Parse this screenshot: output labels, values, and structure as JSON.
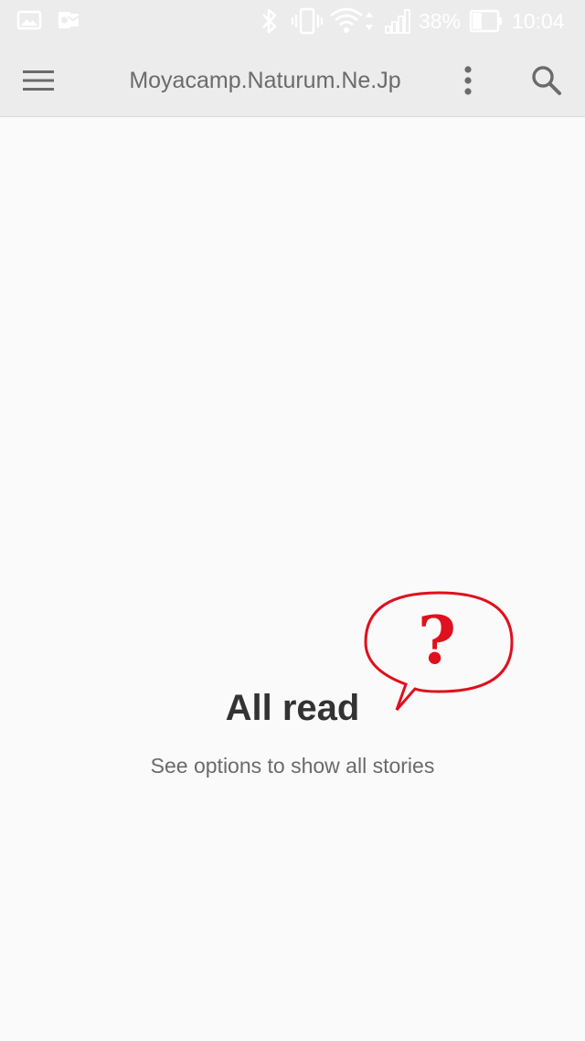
{
  "status_bar": {
    "battery_percent": "38%",
    "time": "10:04",
    "icons": [
      "gallery-icon",
      "outlook-icon",
      "bluetooth-icon",
      "vibrate-icon",
      "wifi-icon",
      "signal-icon",
      "battery-icon"
    ]
  },
  "toolbar": {
    "title": "Moyacamp.Naturum.Ne.Jp",
    "icons": [
      "menu-icon",
      "more-vert-icon",
      "search-icon"
    ]
  },
  "empty_state": {
    "title": "All read",
    "subtitle": "See options to show all stories"
  },
  "annotation": {
    "symbol": "?",
    "color": "#e0101e"
  }
}
